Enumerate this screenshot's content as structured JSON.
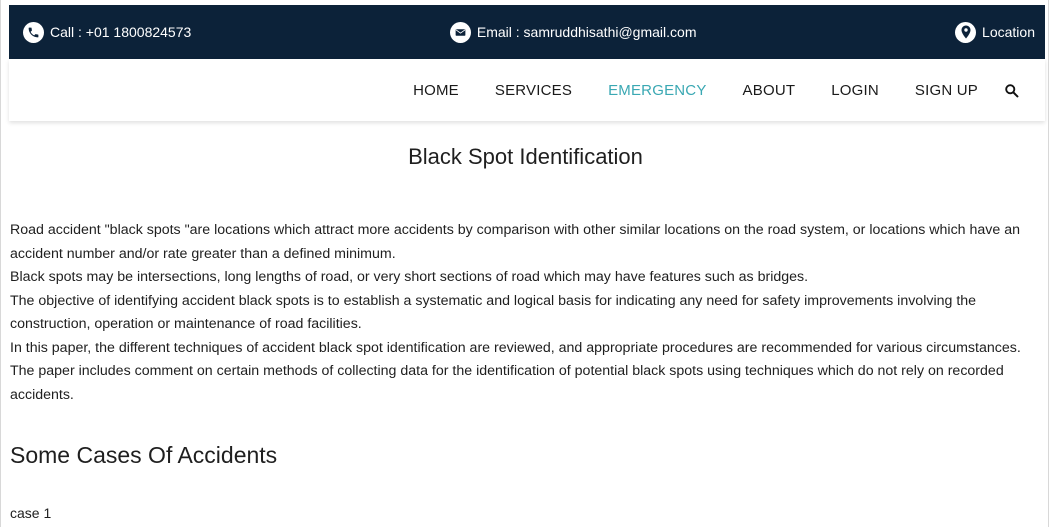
{
  "topbar": {
    "call": "Call : +01 1800824573",
    "email": "Email : samruddhisathi@gmail.com",
    "location": "Location",
    "bg_color": "#0c2239",
    "icons": {
      "call": "phone-icon",
      "email": "mail-icon",
      "location": "map-pin-icon"
    }
  },
  "nav": {
    "items": [
      "HOME",
      "SERVICES",
      "EMERGENCY",
      "ABOUT",
      "LOGIN",
      "SIGN UP"
    ],
    "active": "EMERGENCY",
    "active_color": "#3aa8b3",
    "search_icon": "search-icon"
  },
  "main": {
    "title": "Black Spot Identification",
    "paragraphs": [
      "Road accident \"black spots \"are locations which attract more accidents by comparison with other similar locations on the road system, or locations which have an accident number and/or rate greater than a defined minimum.",
      "Black spots may be intersections, long lengths of road, or very short sections of road which may have features such as bridges.",
      "The objective of identifying accident black spots is to establish a systematic and logical basis for indicating any need for safety improvements involving the construction, operation or maintenance of road facilities.",
      "In this paper, the different techniques of accident black spot identification are reviewed, and appropriate procedures are recommended for various circumstances. The paper includes comment on certain methods of collecting data for the identification of potential black spots using techniques which do not rely on recorded accidents."
    ],
    "section_title": "Some Cases Of Accidents",
    "case_label": "case 1"
  }
}
